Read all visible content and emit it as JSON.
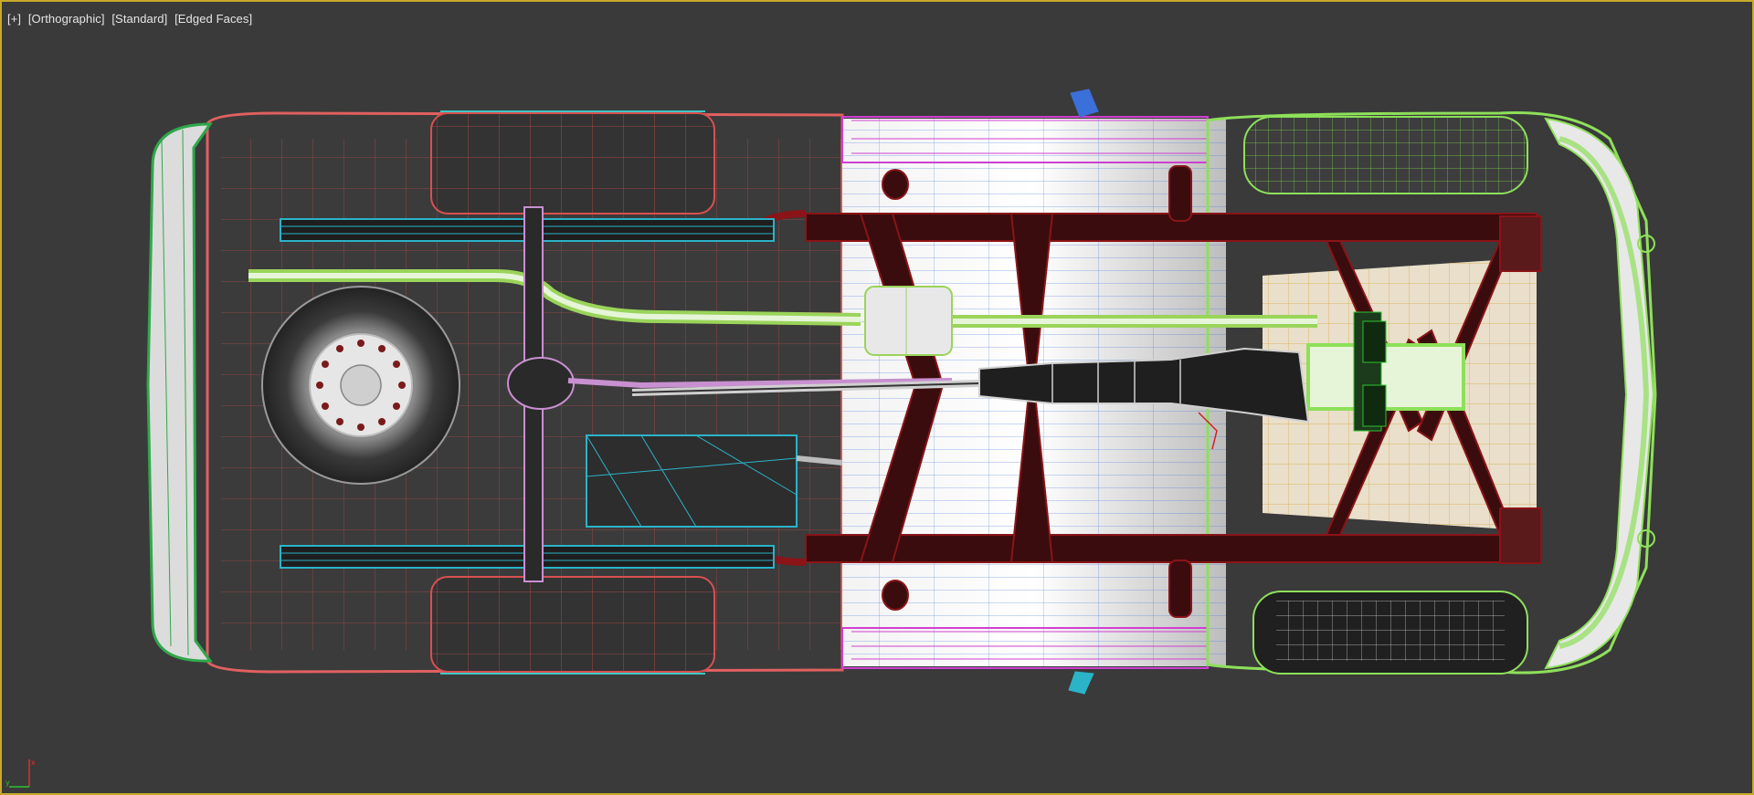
{
  "viewport": {
    "labels": {
      "plus": "[+]",
      "view": "[Orthographic]",
      "shading": "[Standard]",
      "edges": "[Edged Faces]"
    },
    "active_border_color": "#c8a92a",
    "background_color": "#3a3a3a"
  },
  "gizmo": {
    "x_axis_label": "x",
    "y_axis_label": "y",
    "x_axis_color": "#e03030",
    "y_axis_color": "#2ec22e"
  },
  "scene": {
    "description_colors": {
      "rear_body": "#e06060",
      "front_body": "#8ee05a",
      "frame": "#8a1418",
      "wheels": "#bfbfbf",
      "exhaust": "#9ad45a",
      "fuel_tank": "#2bb3c8",
      "doors": "#d040d0",
      "floor_pan": "#e0b040"
    }
  }
}
